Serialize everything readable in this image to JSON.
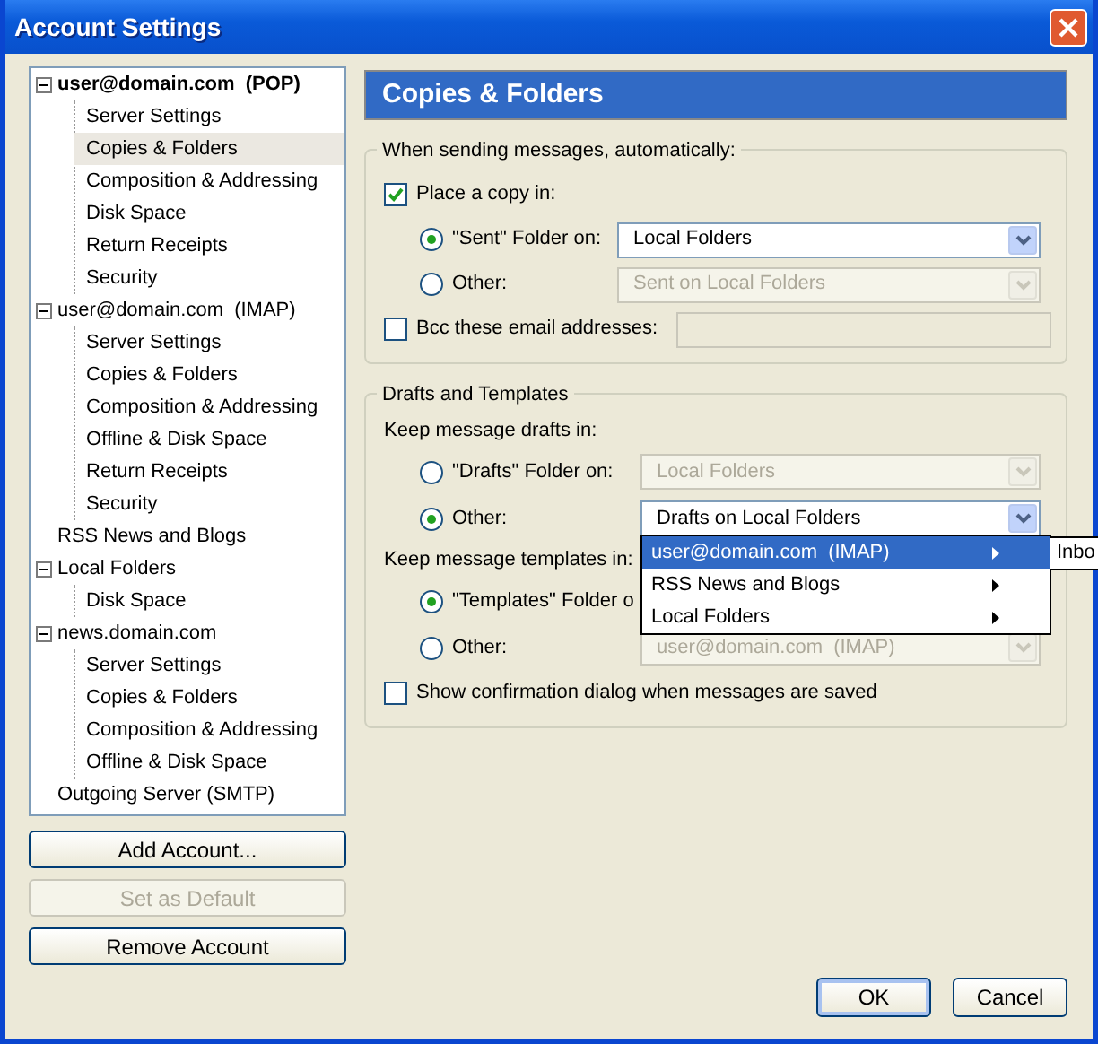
{
  "window": {
    "title": "Account Settings"
  },
  "tree": [
    {
      "label": "user@domain.com  (POP)",
      "default": true,
      "expanded": true,
      "selected": false,
      "children": [
        {
          "label": "Server Settings",
          "selected": false
        },
        {
          "label": "Copies & Folders",
          "selected": true
        },
        {
          "label": "Composition & Addressing",
          "selected": false
        },
        {
          "label": "Disk Space",
          "selected": false
        },
        {
          "label": "Return Receipts",
          "selected": false
        },
        {
          "label": "Security",
          "selected": false
        }
      ]
    },
    {
      "label": "user@domain.com  (IMAP)",
      "default": false,
      "expanded": true,
      "selected": false,
      "children": [
        {
          "label": "Server Settings",
          "selected": false
        },
        {
          "label": "Copies & Folders",
          "selected": false
        },
        {
          "label": "Composition & Addressing",
          "selected": false
        },
        {
          "label": "Offline & Disk Space",
          "selected": false
        },
        {
          "label": "Return Receipts",
          "selected": false
        },
        {
          "label": "Security",
          "selected": false
        }
      ]
    },
    {
      "label": "RSS News and Blogs",
      "default": false,
      "selected": false
    },
    {
      "label": "Local Folders",
      "default": false,
      "expanded": true,
      "selected": false,
      "children": [
        {
          "label": "Disk Space",
          "selected": false
        }
      ]
    },
    {
      "label": "news.domain.com",
      "default": false,
      "expanded": true,
      "selected": false,
      "children": [
        {
          "label": "Server Settings",
          "selected": false
        },
        {
          "label": "Copies & Folders",
          "selected": false
        },
        {
          "label": "Composition & Addressing",
          "selected": false
        },
        {
          "label": "Offline & Disk Space",
          "selected": false
        }
      ]
    },
    {
      "label": "Outgoing Server (SMTP)",
      "default": false,
      "selected": false
    }
  ],
  "account_buttons": [
    {
      "label": "Add Account...",
      "disabled": false
    },
    {
      "label": "Set as Default",
      "disabled": true
    },
    {
      "label": "Remove Account",
      "disabled": false
    }
  ],
  "page_title": "Copies & Folders",
  "sending": {
    "legend": "When sending messages, automatically:",
    "place_copy": {
      "label": "Place a copy in:",
      "checked": true
    },
    "options": [
      {
        "label": "\"Sent\" Folder on:",
        "selected": true,
        "select": {
          "value": "Local Folders",
          "disabled": false
        }
      },
      {
        "label": "Other:",
        "selected": false,
        "select": {
          "value": "Sent on Local Folders",
          "disabled": true
        }
      }
    ],
    "bcc": {
      "label": "Bcc these email addresses:",
      "checked": false,
      "disabled": true
    }
  },
  "drafts": {
    "legend": "Drafts and Templates",
    "groups": [
      {
        "heading": "Keep message drafts in:",
        "options": [
          {
            "label": "\"Drafts\" Folder on:",
            "selected": false,
            "select": {
              "value": "Local Folders",
              "disabled": true
            }
          },
          {
            "label": "Other:",
            "selected": true,
            "select": {
              "value": "Drafts on Local Folders",
              "disabled": false
            },
            "menu": true
          }
        ]
      },
      {
        "heading": "Keep message templates in:",
        "options": [
          {
            "label": "\"Templates\" Folder o",
            "selected": true
          },
          {
            "label": "Other:",
            "selected": false,
            "select": {
              "value": "user@domain.com  (IMAP)",
              "disabled": true
            }
          }
        ]
      }
    ],
    "confirm": {
      "label": "Show confirmation dialog when messages are saved",
      "checked": false
    }
  },
  "folder_menu": {
    "items": [
      {
        "label": "user@domain.com  (IMAP)",
        "selected": true
      },
      {
        "label": "RSS News and Blogs",
        "selected": false
      },
      {
        "label": "Local Folders",
        "selected": false
      }
    ],
    "submenu_item": "Inbo"
  },
  "dialog_buttons": [
    "OK",
    "Cancel"
  ]
}
